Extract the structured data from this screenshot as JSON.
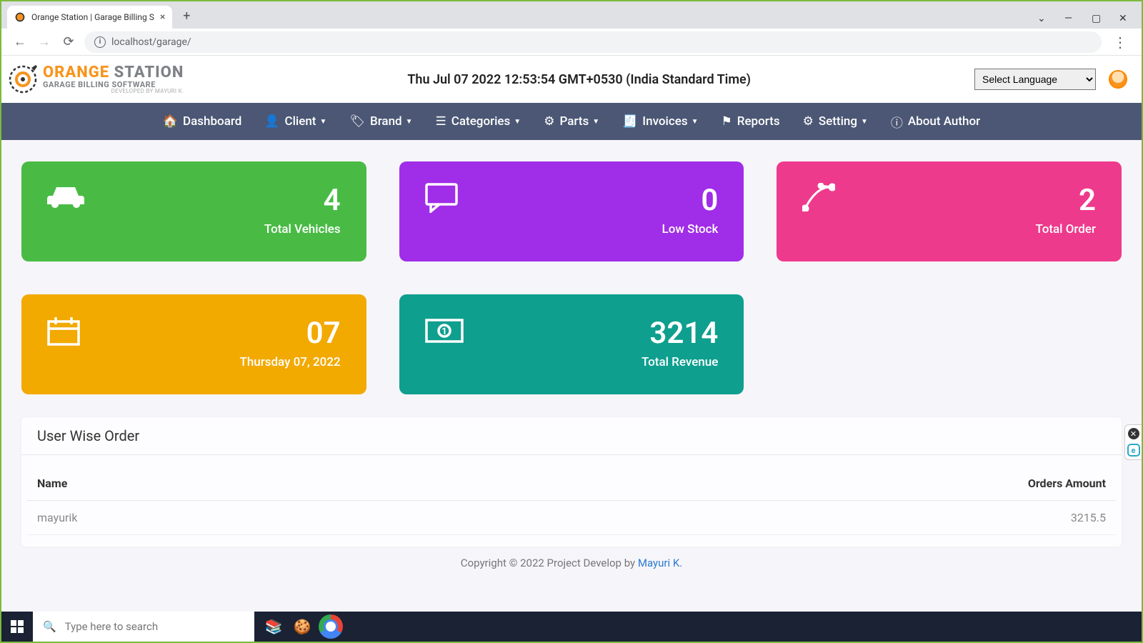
{
  "browser": {
    "tab_title": "Orange Station | Garage Billing S",
    "url": "localhost/garage/"
  },
  "header": {
    "logo_line1_orange": "ORANGE",
    "logo_line1_grey": " STATION",
    "logo_line2": "GARAGE BILLING SOFTWARE",
    "logo_line3": "DEVELOPED BY MAYURI K.",
    "datetime": "Thu Jul 07 2022 12:53:54 GMT+0530 (India Standard Time)",
    "language_selected": "Select Language"
  },
  "nav": {
    "dashboard": "Dashboard",
    "client": "Client",
    "brand": "Brand",
    "categories": "Categories",
    "parts": "Parts",
    "invoices": "Invoices",
    "reports": "Reports",
    "setting": "Setting",
    "about": "About Author"
  },
  "cards": {
    "vehicles": {
      "value": "4",
      "label": "Total Vehicles"
    },
    "lowstock": {
      "value": "0",
      "label": "Low Stock"
    },
    "orders": {
      "value": "2",
      "label": "Total Order"
    },
    "date": {
      "value": "07",
      "label": "Thursday 07, 2022"
    },
    "revenue": {
      "value": "3214",
      "label": "Total Revenue"
    }
  },
  "panel": {
    "title": "User Wise Order",
    "col_name": "Name",
    "col_amount": "Orders Amount",
    "row1_name": "mayurik",
    "row1_amount": "3215.5"
  },
  "footer": {
    "text": "Copyright © 2022 Project Develop by ",
    "link": "Mayuri K."
  },
  "taskbar": {
    "search_placeholder": "Type here to search"
  }
}
